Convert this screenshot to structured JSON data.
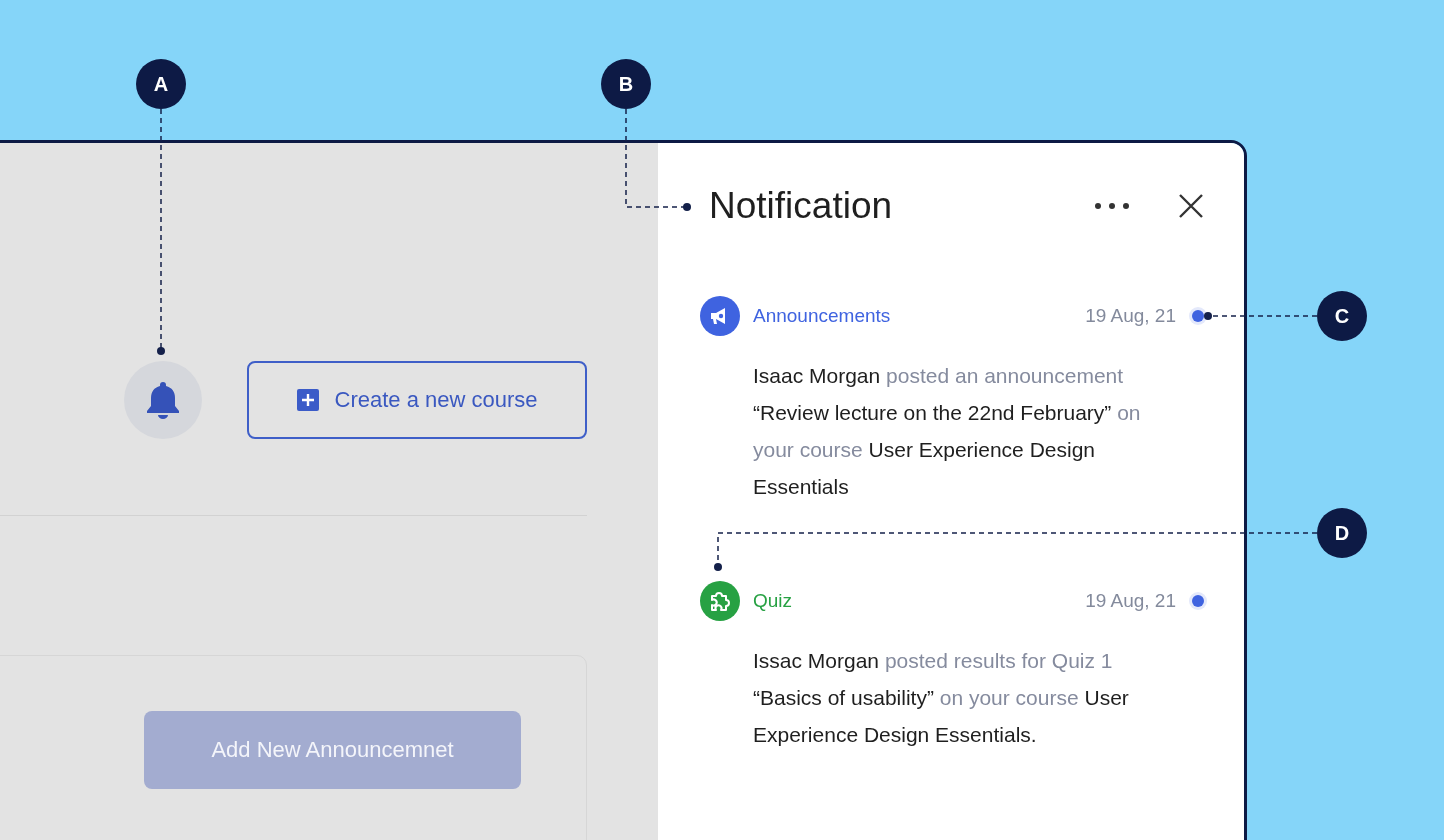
{
  "callouts": [
    {
      "label": "A"
    },
    {
      "label": "B"
    },
    {
      "label": "C"
    },
    {
      "label": "D"
    }
  ],
  "main": {
    "create_button": "Create a new course",
    "add_button": {
      "label": "Add New Announcemnet",
      "disabled": true
    }
  },
  "panel": {
    "title": "Notification",
    "notifications": [
      {
        "kind": "announcement",
        "category": "Announcements",
        "color": "#3f63e0",
        "date": "19 Aug, 21",
        "unread": true,
        "body": [
          {
            "text": "Isaac Morgan",
            "strong": true
          },
          {
            "text": " posted an announcement ",
            "strong": false
          },
          {
            "text": "“Review lecture on the 22nd February”",
            "strong": true
          },
          {
            "text": " on your course ",
            "strong": false
          },
          {
            "text": "User Experience Design Essentials",
            "strong": true
          }
        ]
      },
      {
        "kind": "quiz",
        "category": "Quiz",
        "color": "#27a143",
        "date": "19 Aug, 21",
        "unread": true,
        "body": [
          {
            "text": "Issac Morgan",
            "strong": true
          },
          {
            "text": " posted results for Quiz 1 ",
            "strong": false
          },
          {
            "text": "“Basics of usability”",
            "strong": true
          },
          {
            "text": " on your course ",
            "strong": false
          },
          {
            "text": "User Experience Design Essentials.",
            "strong": true
          }
        ]
      }
    ]
  }
}
